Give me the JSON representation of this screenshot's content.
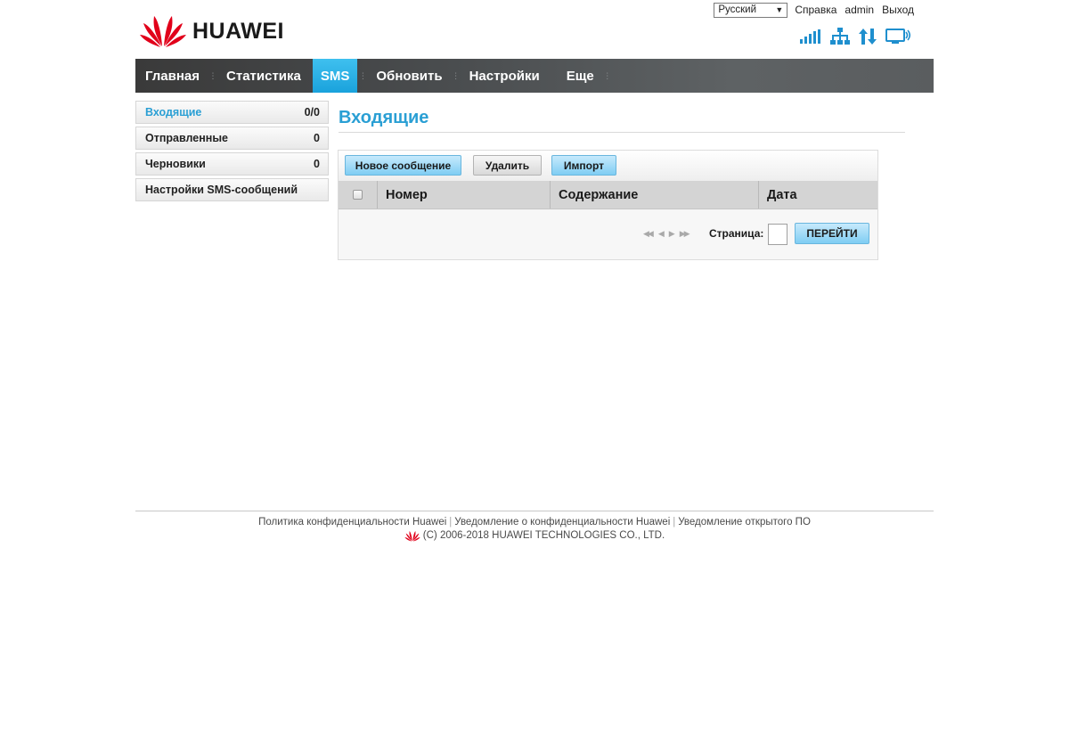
{
  "brand": {
    "name": "HUAWEI",
    "color": "#e1001a"
  },
  "topbar": {
    "language": "Русский",
    "help": "Справка",
    "user": "admin",
    "logout": "Выход"
  },
  "status_icons": [
    "signal-strength-icon",
    "lan-network-icon",
    "data-transfer-icon",
    "monitor-wifi-icon"
  ],
  "nav": {
    "items": [
      {
        "label": "Главная"
      },
      {
        "label": "Статистика"
      },
      {
        "label": "SMS",
        "active": true
      },
      {
        "label": "Обновить"
      },
      {
        "label": "Настройки"
      },
      {
        "label": "Еще"
      }
    ]
  },
  "sidebar": {
    "items": [
      {
        "label": "Входящие",
        "count": "0/0",
        "active": true
      },
      {
        "label": "Отправленные",
        "count": "0"
      },
      {
        "label": "Черновики",
        "count": "0"
      },
      {
        "label": "Настройки SMS-сообщений",
        "count": ""
      }
    ]
  },
  "main": {
    "title": "Входящие",
    "toolbar": {
      "new_message": "Новое сообщение",
      "delete": "Удалить",
      "import": "Импорт"
    },
    "table": {
      "columns": [
        "Номер",
        "Содержание",
        "Дата"
      ],
      "rows": []
    },
    "pager": {
      "page_label": "Страница:",
      "go": "ПЕРЕЙТИ"
    }
  },
  "footer": {
    "links": [
      "Политика конфиденциальности Huawei",
      "Уведомление о конфиденциальности Huawei",
      "Уведомление открытого ПО"
    ],
    "copyright": "(C) 2006-2018 HUAWEI TECHNOLOGIES CO., LTD."
  },
  "colors": {
    "accent": "#2a9fd4",
    "active_tab": "#1aa2dc",
    "icon_blue": "#1f8fce"
  }
}
